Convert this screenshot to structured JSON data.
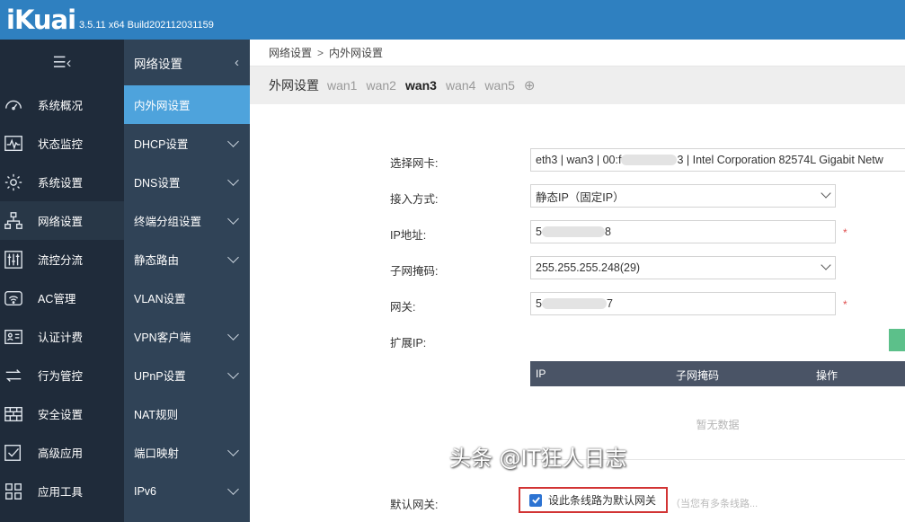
{
  "app": {
    "logo": "iKuai",
    "version": "3.5.11 x64 Build202112031159"
  },
  "nav1": {
    "toggle_icon": "menu-collapse-icon",
    "items": [
      {
        "label": "系统概况",
        "icon": "dashboard-icon"
      },
      {
        "label": "状态监控",
        "icon": "monitor-icon"
      },
      {
        "label": "系统设置",
        "icon": "gear-icon"
      },
      {
        "label": "网络设置",
        "icon": "network-icon",
        "active": true
      },
      {
        "label": "流控分流",
        "icon": "sliders-icon"
      },
      {
        "label": "AC管理",
        "icon": "wifi-icon"
      },
      {
        "label": "认证计费",
        "icon": "id-card-icon"
      },
      {
        "label": "行为管控",
        "icon": "arrows-icon"
      },
      {
        "label": "安全设置",
        "icon": "firewall-icon"
      },
      {
        "label": "高级应用",
        "icon": "check-box-icon"
      },
      {
        "label": "应用工具",
        "icon": "apps-icon"
      }
    ]
  },
  "nav2": {
    "title": "网络设置",
    "items": [
      {
        "label": "内外网设置",
        "active": true,
        "expandable": false
      },
      {
        "label": "DHCP设置",
        "expandable": true
      },
      {
        "label": "DNS设置",
        "expandable": true
      },
      {
        "label": "终端分组设置",
        "expandable": true
      },
      {
        "label": "静态路由",
        "expandable": true
      },
      {
        "label": "VLAN设置",
        "expandable": false
      },
      {
        "label": "VPN客户端",
        "expandable": true
      },
      {
        "label": "UPnP设置",
        "expandable": true
      },
      {
        "label": "NAT规则",
        "expandable": false
      },
      {
        "label": "端口映射",
        "expandable": true
      },
      {
        "label": "IPv6",
        "expandable": true
      }
    ]
  },
  "breadcrumb": {
    "parent": "网络设置",
    "separator": ">",
    "current": "内外网设置"
  },
  "tabs": {
    "label": "外网设置",
    "items": [
      {
        "label": "wan1"
      },
      {
        "label": "wan2"
      },
      {
        "label": "wan3",
        "active": true
      },
      {
        "label": "wan4"
      },
      {
        "label": "wan5"
      }
    ],
    "add": "⊕"
  },
  "form": {
    "nic": {
      "label": "选择网卡:",
      "value_start": "eth3 | wan3 | 00:f",
      "value_end": "3 | Intel Corporation 82574L Gigabit Netw"
    },
    "access": {
      "label": "接入方式:",
      "value": "静态IP（固定IP）"
    },
    "ip": {
      "label": "IP地址:",
      "value_start": "5",
      "value_end": "8",
      "required": "*"
    },
    "mask": {
      "label": "子网掩码:",
      "value": "255.255.255.248(29)"
    },
    "gateway": {
      "label": "网关:",
      "value_start": "5",
      "value_end": "7",
      "required": "*"
    },
    "ext_ip": {
      "label": "扩展IP:"
    },
    "table": {
      "columns": [
        "IP",
        "子网掩码",
        "操作"
      ],
      "empty": "暂无数据"
    },
    "default_gw": {
      "label": "默认网关:",
      "checkbox_label": "设此条线路为默认网关",
      "checked": true,
      "hint": "（当您有多条线路..."
    }
  },
  "watermark": "头条 @IT狂人日志",
  "colors": {
    "topbar": "#2f80c0",
    "nav_bg": "#1f2b3a",
    "subnav_bg": "#304357",
    "subnav_active": "#4ea3dc",
    "table_head": "#4a5466",
    "add_button": "#5cc08a",
    "highlight_border": "#d23434"
  }
}
